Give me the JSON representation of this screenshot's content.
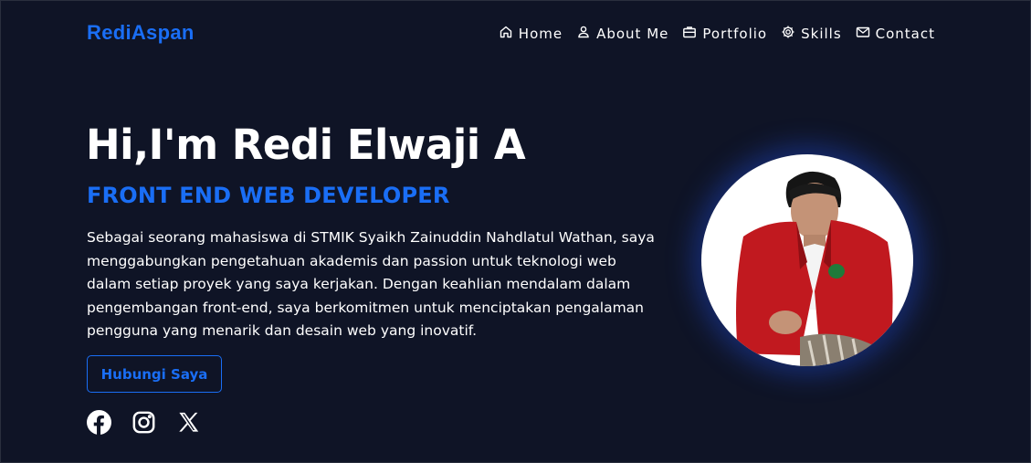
{
  "brand": {
    "name": "RediAspan",
    "color": "#1a6ef5"
  },
  "nav": {
    "items": [
      {
        "label": "Home",
        "icon": "home-icon"
      },
      {
        "label": "About Me",
        "icon": "user-icon"
      },
      {
        "label": "Portfolio",
        "icon": "briefcase-icon"
      },
      {
        "label": "Skills",
        "icon": "gear-icon"
      },
      {
        "label": "Contact",
        "icon": "envelope-icon"
      }
    ]
  },
  "hero": {
    "title": "Hi,I'm Redi Elwaji A",
    "role": "FRONT END WEB DEVELOPER",
    "description": "Sebagai seorang mahasiswa di STMIK Syaikh Zainuddin Nahdlatul Wathan, saya menggabungkan pengetahuan akademis dan passion untuk teknologi web dalam setiap proyek yang saya kerjakan. Dengan keahlian mendalam dalam pengembangan front-end, saya berkomitmen untuk menciptakan pengalaman pengguna yang menarik dan desain web yang inovatif.",
    "cta_label": "Hubungi Saya"
  },
  "socials": [
    {
      "icon": "facebook-icon"
    },
    {
      "icon": "instagram-icon"
    },
    {
      "icon": "x-twitter-icon"
    }
  ],
  "colors": {
    "background": "#0f1426",
    "accent": "#1a6ef5",
    "text": "#ffffff",
    "avatar_glow": "#1e46c8"
  }
}
